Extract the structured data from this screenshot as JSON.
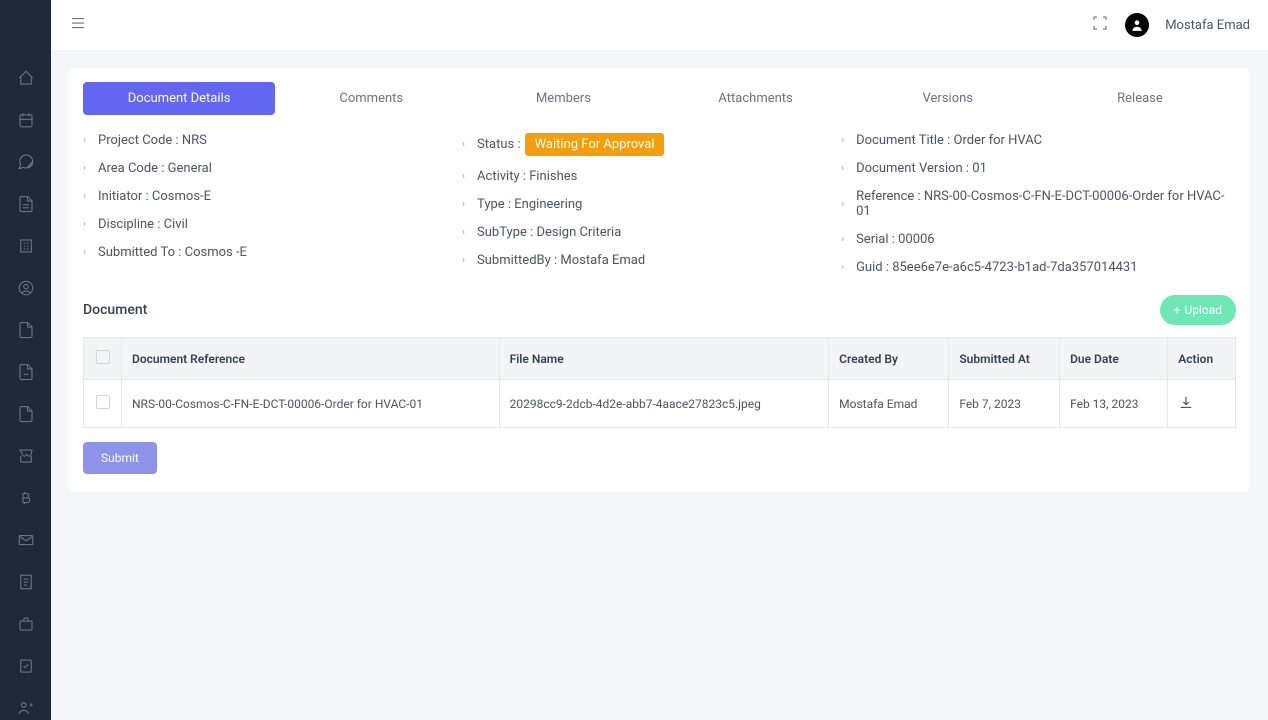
{
  "header": {
    "username": "Mostafa Emad"
  },
  "tabs": [
    {
      "label": "Document Details",
      "active": true
    },
    {
      "label": "Comments",
      "active": false
    },
    {
      "label": "Members",
      "active": false
    },
    {
      "label": "Attachments",
      "active": false
    },
    {
      "label": "Versions",
      "active": false
    },
    {
      "label": "Release",
      "active": false
    }
  ],
  "details": {
    "col1": [
      {
        "label": "Project Code : NRS"
      },
      {
        "label": "Area Code : General"
      },
      {
        "label": "Initiator : Cosmos-E"
      },
      {
        "label": "Discipline : Civil"
      },
      {
        "label": "Submitted To : Cosmos -E"
      }
    ],
    "col2": [
      {
        "label": "Status :",
        "badge": "Waiting For Approval"
      },
      {
        "label": "Activity : Finishes"
      },
      {
        "label": "Type : Engineering"
      },
      {
        "label": "SubType : Design Criteria"
      },
      {
        "label": "SubmittedBy : Mostafa Emad"
      }
    ],
    "col3": [
      {
        "label": "Document Title : Order for HVAC"
      },
      {
        "label": "Document Version : 01"
      },
      {
        "label": "Reference : NRS-00-Cosmos-C-FN-E-DCT-00006-Order for HVAC-01"
      },
      {
        "label": "Serial : 00006"
      },
      {
        "label": "Guid : 85ee6e7e-a6c5-4723-b1ad-7da357014431"
      }
    ]
  },
  "document": {
    "section_title": "Document",
    "upload_label": "Upload",
    "columns": {
      "ref": "Document Reference",
      "file": "File Name",
      "created": "Created By",
      "submitted": "Submitted At",
      "due": "Due Date",
      "action": "Action"
    },
    "rows": [
      {
        "ref": "NRS-00-Cosmos-C-FN-E-DCT-00006-Order for HVAC-01",
        "file": "20298cc9-2dcb-4d2e-abb7-4aace27823c5.jpeg",
        "created": "Mostafa Emad",
        "submitted": "Feb 7, 2023",
        "due": "Feb 13, 2023"
      }
    ]
  },
  "submit_label": "Submit"
}
